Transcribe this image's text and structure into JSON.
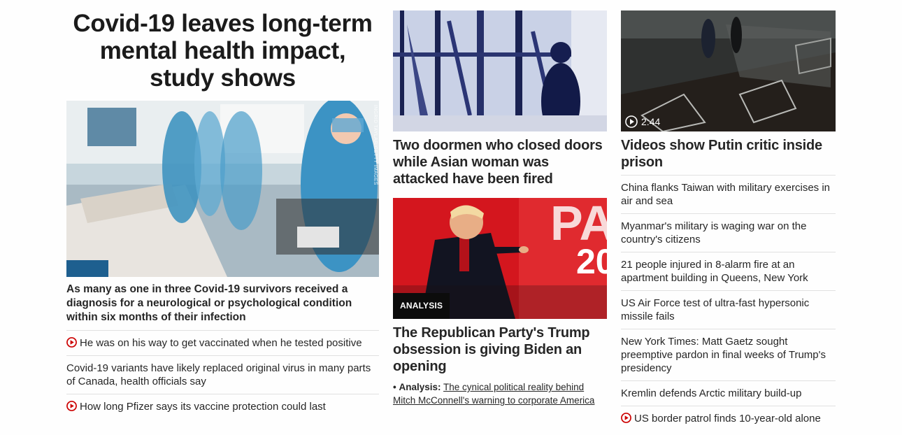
{
  "col1": {
    "headline": "Covid-19 leaves long-term mental health impact, study shows",
    "photo_credit": "INGRID TAYLAR/GETTY IMAGES",
    "lead_text": "As many as one in three Covid-19 survivors received a diagnosis for a neurological or psychological condition within six months of their infection",
    "items": [
      {
        "text": "He was on his way to get vaccinated when he tested positive",
        "video": true
      },
      {
        "text": "Covid-19 variants have likely replaced original virus in many parts of Canada, health officials say",
        "video": false
      },
      {
        "text": "How long Pfizer says its vaccine protection could last",
        "video": true
      }
    ]
  },
  "col2": {
    "story1_title": "Two doormen who closed doors while Asian woman was attacked have been fired",
    "story2_badge": "ANALYSIS",
    "story2_title": "The Republican Party's Trump obsession is giving Biden an opening",
    "analysis_bullet": "•",
    "analysis_label": "Analysis:",
    "analysis_link": "The cynical political reality behind Mitch McConnell's warning to corporate America"
  },
  "col3": {
    "video_duration": "2:44",
    "headline": "Videos show Putin critic inside prison",
    "items": [
      {
        "text": "China flanks Taiwan with military exercises in air and sea",
        "video": false
      },
      {
        "text": "Myanmar's military is waging war on the country's citizens",
        "video": false
      },
      {
        "text": "21 people injured in 8-alarm fire at an apartment building in Queens, New York",
        "video": false
      },
      {
        "text": "US Air Force test of ultra-fast hypersonic missile fails",
        "video": false
      },
      {
        "text": "New York Times: Matt Gaetz sought preemptive pardon in final weeks of Trump's presidency",
        "video": false
      },
      {
        "text": "Kremlin defends Arctic military build-up",
        "video": false
      },
      {
        "text": "US border patrol finds 10-year-old alone",
        "video": true
      }
    ]
  },
  "colors": {
    "accent_red": "#cc0000",
    "badge_bg": "#0c0c0c",
    "divider": "#e1e1e1"
  },
  "icons": {
    "video": "play-circle-icon"
  }
}
